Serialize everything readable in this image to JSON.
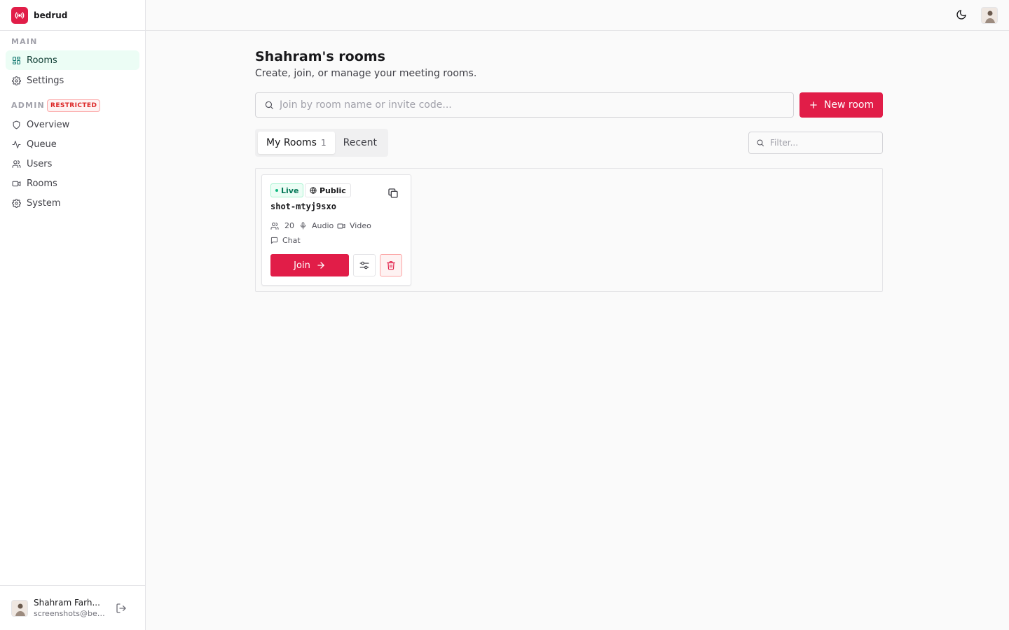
{
  "app": {
    "name": "bedrud",
    "accent_color": "#e11d48"
  },
  "sidebar": {
    "main_label": "MAIN",
    "main_items": [
      {
        "label": "Rooms",
        "icon": "grid-icon",
        "active": true
      },
      {
        "label": "Settings",
        "icon": "gear-icon",
        "active": false
      }
    ],
    "admin_label": "ADMIN",
    "admin_badge": "RESTRICTED",
    "admin_items": [
      {
        "label": "Overview",
        "icon": "shield-icon"
      },
      {
        "label": "Queue",
        "icon": "activity-icon"
      },
      {
        "label": "Users",
        "icon": "users-icon"
      },
      {
        "label": "Rooms",
        "icon": "video-icon"
      },
      {
        "label": "System",
        "icon": "gear-icon"
      }
    ],
    "user": {
      "name": "Shahram Farh...",
      "email": "screenshots@bed..."
    }
  },
  "header": {
    "theme_icon": "moon-icon"
  },
  "main": {
    "title": "Shahram's rooms",
    "subtitle": "Create, join, or manage your meeting rooms.",
    "join_placeholder": "Join by room name or invite code...",
    "new_room_label": "New room",
    "tabs": [
      {
        "label": "My Rooms",
        "count": "1",
        "active": true
      },
      {
        "label": "Recent",
        "count": "",
        "active": false
      }
    ],
    "filter_placeholder": "Filter...",
    "rooms": [
      {
        "status": "Live",
        "visibility": "Public",
        "name": "shot-mtyj9sxo",
        "participants": "20",
        "features": [
          "Audio",
          "Video",
          "Chat"
        ],
        "join_label": "Join"
      }
    ]
  }
}
